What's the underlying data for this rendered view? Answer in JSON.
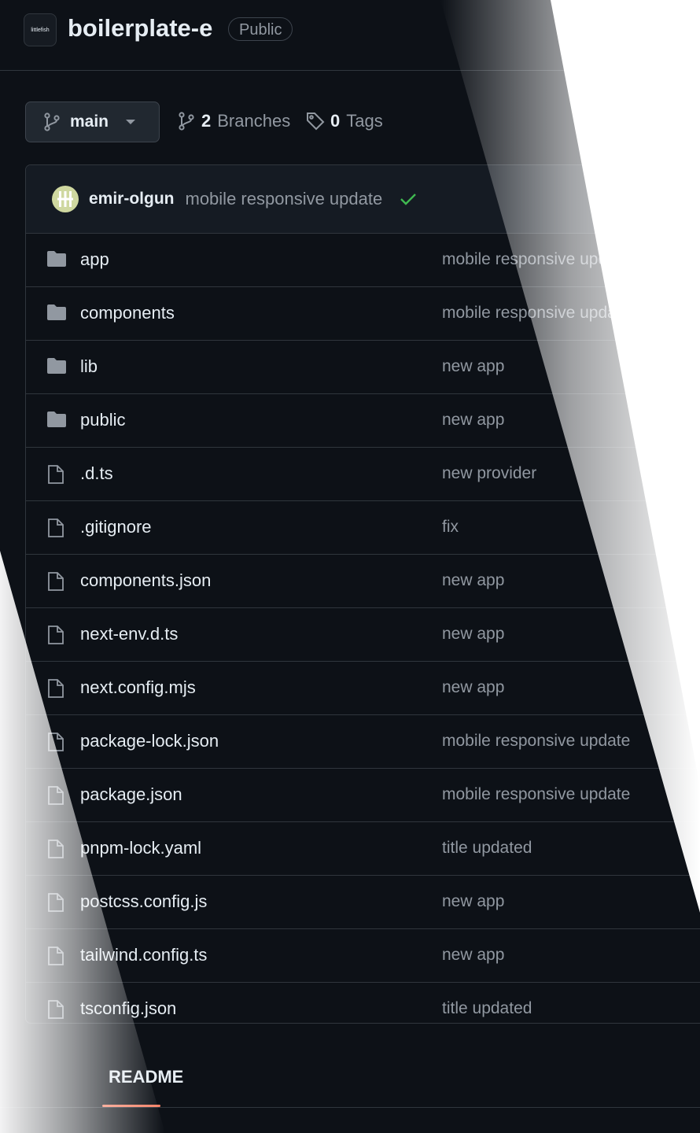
{
  "header": {
    "logo_text": "littlefish",
    "repo_name": "boilerplate-e",
    "visibility": "Public"
  },
  "toolbar": {
    "branch": "main",
    "branches_count": "2",
    "branches_label": "Branches",
    "tags_count": "0",
    "tags_label": "Tags"
  },
  "commit": {
    "author": "emir-olgun",
    "message": "mobile responsive update",
    "status": "success"
  },
  "files": [
    {
      "name": "app",
      "type": "folder",
      "message": "mobile responsive update"
    },
    {
      "name": "components",
      "type": "folder",
      "message": "mobile responsive update"
    },
    {
      "name": "lib",
      "type": "folder",
      "message": "new app"
    },
    {
      "name": "public",
      "type": "folder",
      "message": "new app"
    },
    {
      "name": ".d.ts",
      "type": "file",
      "message": "new provider"
    },
    {
      "name": ".gitignore",
      "type": "file",
      "message": "fix"
    },
    {
      "name": "components.json",
      "type": "file",
      "message": "new app"
    },
    {
      "name": "next-env.d.ts",
      "type": "file",
      "message": "new app"
    },
    {
      "name": "next.config.mjs",
      "type": "file",
      "message": "new app"
    },
    {
      "name": "package-lock.json",
      "type": "file",
      "message": "mobile responsive update"
    },
    {
      "name": "package.json",
      "type": "file",
      "message": "mobile responsive update"
    },
    {
      "name": "pnpm-lock.yaml",
      "type": "file",
      "message": "title updated"
    },
    {
      "name": "postcss.config.js",
      "type": "file",
      "message": "new app"
    },
    {
      "name": "tailwind.config.ts",
      "type": "file",
      "message": "new app"
    },
    {
      "name": "tsconfig.json",
      "type": "file",
      "message": "title updated"
    }
  ],
  "readme": {
    "tab_label": "README"
  },
  "colors": {
    "background": "#0d1117",
    "border": "#30363d",
    "muted_text": "#9198a1",
    "accent_underline": "#f78166",
    "check_green": "#3fb950"
  }
}
